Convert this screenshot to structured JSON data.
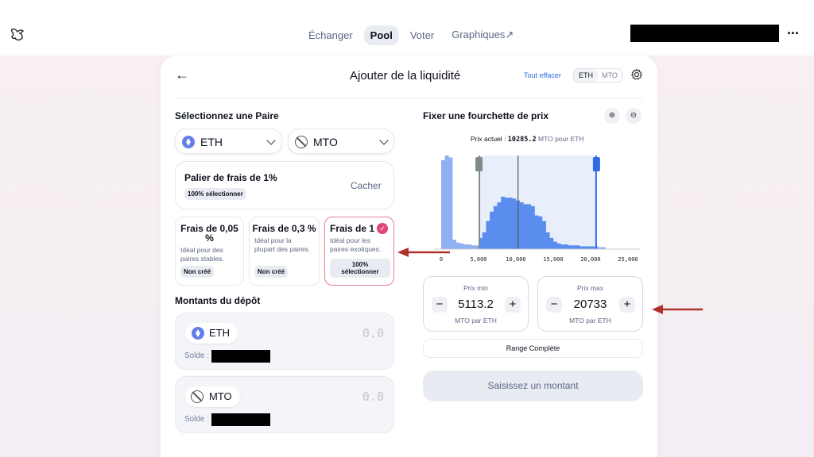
{
  "nav": {
    "items": [
      {
        "label": "Échanger",
        "active": false
      },
      {
        "label": "Pool",
        "active": true
      },
      {
        "label": "Voter",
        "active": false
      },
      {
        "label": "Graphiques↗",
        "active": false
      }
    ],
    "more_label": "···"
  },
  "card": {
    "title": "Ajouter de la liquidité",
    "clear_all": "Tout effacer",
    "toggle": [
      "ETH",
      "MTO"
    ]
  },
  "pair": {
    "heading": "Sélectionnez une Paire",
    "token_a": "ETH",
    "token_b": "MTO"
  },
  "fee_tier": {
    "title": "Palier de frais de 1%",
    "badge": "100% sélectionner",
    "hide_label": "Cacher"
  },
  "fee_options": [
    {
      "title": "Frais de 0,05 %",
      "desc": "Idéal pour des paires stables.",
      "badge": "Non créé",
      "selected": false
    },
    {
      "title": "Frais de 0,3 %",
      "desc": "Idéal pour la plupart des paires.",
      "badge": "Non créé",
      "selected": false
    },
    {
      "title": "Frais de 1 %",
      "desc": "Idéal pour les paires exotiques.",
      "badge": "100% sélectionner",
      "selected": true
    }
  ],
  "deposit": {
    "heading": "Montants du dépôt",
    "inputs": [
      {
        "token": "ETH",
        "amount": "0.0",
        "balance_label": "Solde :"
      },
      {
        "token": "MTO",
        "amount": "0.0",
        "balance_label": "Solde :"
      }
    ]
  },
  "range": {
    "heading": "Fixer une fourchette de prix",
    "current_label": "Prix actuel :",
    "current_value": "10285.2",
    "current_unit": "MTO pour ETH",
    "min": {
      "label": "Prix min",
      "value": "5113.2",
      "unit": "MTO par ETH"
    },
    "max": {
      "label": "Prix max",
      "value": "20733",
      "unit": "MTO par ETH"
    },
    "full_range": "Range Complète",
    "cta": "Saisissez un montant"
  },
  "chart_data": {
    "type": "bar",
    "x_ticks": [
      "0",
      "5,000",
      "10,000",
      "15,000",
      "20,000",
      "25,000"
    ],
    "x": [
      250,
      750,
      1250,
      1750,
      2250,
      2750,
      3250,
      3750,
      4250,
      4750,
      5250,
      5750,
      6250,
      6750,
      7250,
      7750,
      8250,
      8750,
      9250,
      9750,
      10250,
      10750,
      11250,
      11750,
      12250,
      12750,
      13250,
      13750,
      14250,
      14750,
      15250,
      15750,
      16250,
      16750,
      17250,
      17750,
      18250,
      18750,
      19250,
      19750,
      20250,
      20750,
      21250,
      21750
    ],
    "values": [
      95,
      100,
      98,
      10,
      7,
      6,
      5,
      5,
      4,
      4,
      12,
      18,
      30,
      40,
      46,
      50,
      56,
      55,
      55,
      54,
      52,
      50,
      48,
      48,
      46,
      36,
      35,
      30,
      18,
      12,
      8,
      6,
      5,
      5,
      4,
      4,
      4,
      3,
      3,
      3,
      3,
      3,
      2,
      2
    ],
    "xlim": [
      0,
      27000
    ],
    "ylim": [
      0,
      100
    ],
    "current_price": 10285.2,
    "range_min": 5113.2,
    "range_max": 20733,
    "colors": {
      "bar": "#5b8def",
      "bar_out": "#8fb0f2",
      "range_fill": "#e9eefb",
      "handle_min": "#7d8c86",
      "handle_max": "#2f6be0"
    }
  }
}
